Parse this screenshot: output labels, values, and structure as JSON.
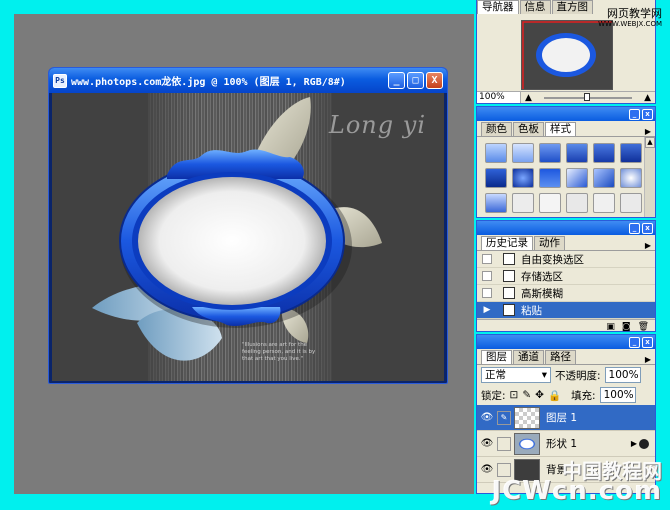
{
  "document": {
    "title": "www.photops.com龙依.jpg @ 100% (图层 1, RGB/8#)",
    "logo_text": "Long yi",
    "quote_text": "\"Illusions are art for the feeling person, and it is by that art that you live.\""
  },
  "window_buttons": {
    "minimize": "_",
    "maximize": "□",
    "close": "X"
  },
  "navigator": {
    "tabs": [
      "导航器",
      "信息",
      "直方图"
    ],
    "zoom": "100%"
  },
  "styles_panel": {
    "tabs": [
      "颜色",
      "色板",
      "样式"
    ],
    "active_tab": 2
  },
  "history_panel": {
    "tabs": [
      "历史记录",
      "动作"
    ],
    "items": [
      "自由变换选区",
      "存储选区",
      "高斯模糊",
      "粘贴"
    ],
    "active_index": 3
  },
  "layers_panel": {
    "tabs": [
      "图层",
      "通道",
      "路径"
    ],
    "blend_mode": "正常",
    "opacity_label": "不透明度:",
    "opacity_value": "100%",
    "lock_label": "锁定:",
    "fill_label": "填充:",
    "fill_value": "100%",
    "layers": [
      {
        "name": "图层 1",
        "active": true
      },
      {
        "name": "形状 1",
        "active": false
      },
      {
        "name": "背景",
        "active": false
      }
    ]
  },
  "watermarks": {
    "top_cn": "网页教学网",
    "top_en": "WWW.WEBJX.COM",
    "bottom_cn": "中国教程网",
    "bottom_en": "JCWcn.com"
  },
  "colors": {
    "window_blue": "#0a5ce0",
    "background_cyan": "#00f0ee",
    "selection_blue": "#316ac5"
  }
}
